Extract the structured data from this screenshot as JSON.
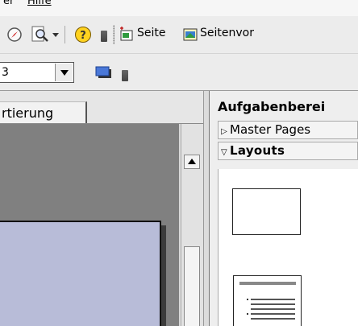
{
  "menubar": {
    "partial_left": "er",
    "help": "Hilfe"
  },
  "toolbar1": {
    "slide_label": "Seite",
    "slide_design_label": "Seitenvor",
    "icons": [
      "navigator-icon",
      "zoom-icon",
      "help-icon",
      "new-slide-icon",
      "slide-design-icon"
    ]
  },
  "toolbar2": {
    "combo_value": "3"
  },
  "tabs": {
    "active_tab": "rtierung"
  },
  "taskpane": {
    "title": "Aufgabenberei",
    "sections": [
      {
        "label": "Master Pages",
        "expanded": false
      },
      {
        "label": "Layouts",
        "expanded": true
      }
    ]
  },
  "colors": {
    "page_fill": "#b8bcd8",
    "canvas_bg": "#808080"
  }
}
